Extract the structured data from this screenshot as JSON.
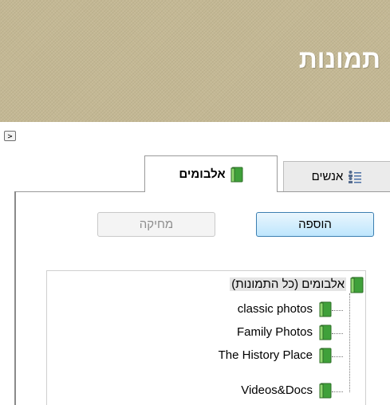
{
  "header": {
    "title": "תמונות"
  },
  "panel": {
    "collapse_glyph": ">"
  },
  "tabs": [
    {
      "label": "אנשים",
      "icon": "people-list-icon",
      "selected": false
    },
    {
      "label": "אלבומים",
      "icon": "album-book-icon",
      "selected": true
    }
  ],
  "actions": {
    "add_label": "הוספה",
    "delete_label": "מחיקה",
    "delete_enabled": false
  },
  "tree": {
    "root": {
      "label": "אלבומים (כל התמונות)",
      "icon": "album-book-icon"
    },
    "items": [
      {
        "label": "classic photos",
        "icon": "album-book-icon"
      },
      {
        "label": "Family Photos",
        "icon": "album-book-icon"
      },
      {
        "label": "The History Place",
        "icon": "album-book-icon"
      },
      {
        "label": "Videos&Docs",
        "icon": "album-book-icon"
      }
    ]
  },
  "colors": {
    "header_bg": "#c4b894",
    "accent_button": "#3c7fb1",
    "book_green": "#3fa03a"
  }
}
